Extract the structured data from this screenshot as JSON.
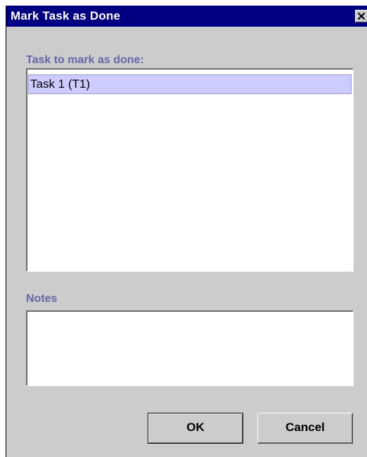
{
  "dialog": {
    "title": "Mark Task as Done",
    "close_icon": "close-x-icon"
  },
  "task_section": {
    "label": "Task to mark as done:",
    "items": [
      {
        "label": "Task 1 (T1)",
        "selected": true
      }
    ]
  },
  "notes_section": {
    "label": "Notes",
    "value": ""
  },
  "buttons": {
    "ok_label": "OK",
    "cancel_label": "Cancel"
  },
  "colors": {
    "titlebar": "#000080",
    "dialog_bg": "#cccccc",
    "section_label": "#6666a8",
    "selection_bg": "#ccccff"
  }
}
